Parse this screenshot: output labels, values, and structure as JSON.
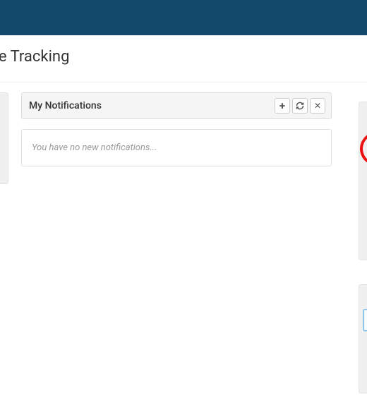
{
  "header": {
    "page_title": "orage Tracking"
  },
  "notifications": {
    "title": "My Notifications",
    "empty_message": "You have no new notifications...",
    "actions": {
      "add": "+",
      "refresh": "refresh",
      "close": "✕"
    }
  }
}
